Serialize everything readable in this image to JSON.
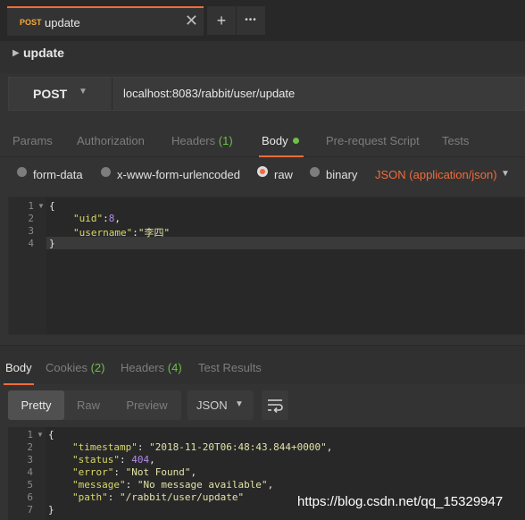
{
  "tab": {
    "method": "POST",
    "name": "update",
    "close": "✕"
  },
  "tab_buttons": {
    "add": "+",
    "more": "•••"
  },
  "request": {
    "title": "update",
    "method": "POST",
    "url": "localhost:8083/rabbit/user/update"
  },
  "request_tabs": {
    "params": "Params",
    "authorization": "Authorization",
    "headers": "Headers",
    "headers_count": "(1)",
    "body": "Body",
    "pre_request": "Pre-request Script",
    "tests": "Tests"
  },
  "body_types": {
    "form_data": "form-data",
    "urlencoded": "x-www-form-urlencoded",
    "raw": "raw",
    "binary": "binary",
    "json_selector": "JSON (application/json)",
    "selected": "raw"
  },
  "request_body": {
    "line_numbers": [
      "1",
      "2",
      "3",
      "4"
    ],
    "open_brace": "{",
    "close_brace": "}",
    "uid_key": "\"uid\"",
    "uid_value": "8",
    "username_key": "\"username\"",
    "username_value": "\"李四\""
  },
  "response_tabs": {
    "body": "Body",
    "cookies": "Cookies",
    "cookies_count": "(2)",
    "headers": "Headers",
    "headers_count": "(4)",
    "test_results": "Test Results"
  },
  "response_view": {
    "pretty": "Pretty",
    "raw": "Raw",
    "preview": "Preview",
    "format": "JSON"
  },
  "response_body": {
    "line_numbers": [
      "1",
      "2",
      "3",
      "4",
      "5",
      "6",
      "7"
    ],
    "open_brace": "{",
    "close_brace": "}",
    "timestamp_key": "\"timestamp\"",
    "timestamp_value": "\"2018-11-20T06:48:43.844+0000\"",
    "status_key": "\"status\"",
    "status_value": "404",
    "error_key": "\"error\"",
    "error_value": "\"Not Found\"",
    "message_key": "\"message\"",
    "message_value": "\"No message available\"",
    "path_key": "\"path\"",
    "path_value": "\"/rabbit/user/update\""
  },
  "watermark": "https://blog.csdn.net/qq_15329947",
  "colors": {
    "accent": "#f26b3a",
    "count": "#6fbf4a",
    "method_badge": "#f7a93b"
  }
}
